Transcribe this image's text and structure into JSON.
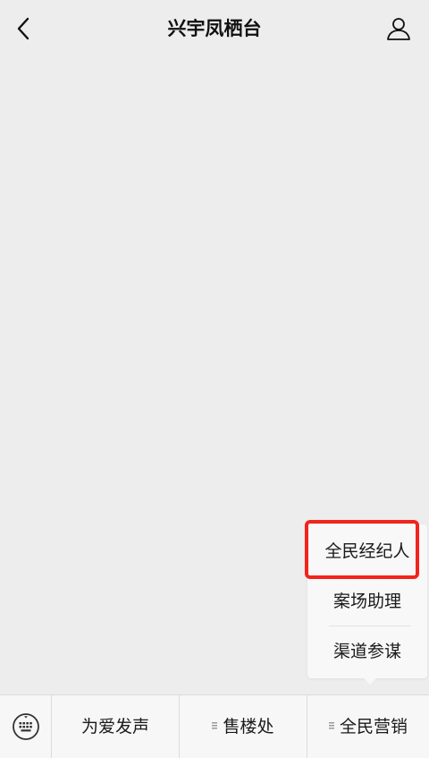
{
  "header": {
    "title": "兴宇凤栖台",
    "back_icon": "chevron-left-icon",
    "profile_icon": "user-icon"
  },
  "popup_menu": {
    "items": [
      {
        "label": "全民经纪人",
        "highlighted": true
      },
      {
        "label": "案场助理"
      },
      {
        "label": "渠道参谋"
      }
    ],
    "highlight_color": "#f2241c"
  },
  "bottom_menu": {
    "keyboard_icon": "keyboard-icon",
    "items": [
      {
        "label": "为爱发声",
        "has_submenu": false
      },
      {
        "label": "售楼处",
        "has_submenu": true
      },
      {
        "label": "全民营销",
        "has_submenu": true
      }
    ]
  }
}
